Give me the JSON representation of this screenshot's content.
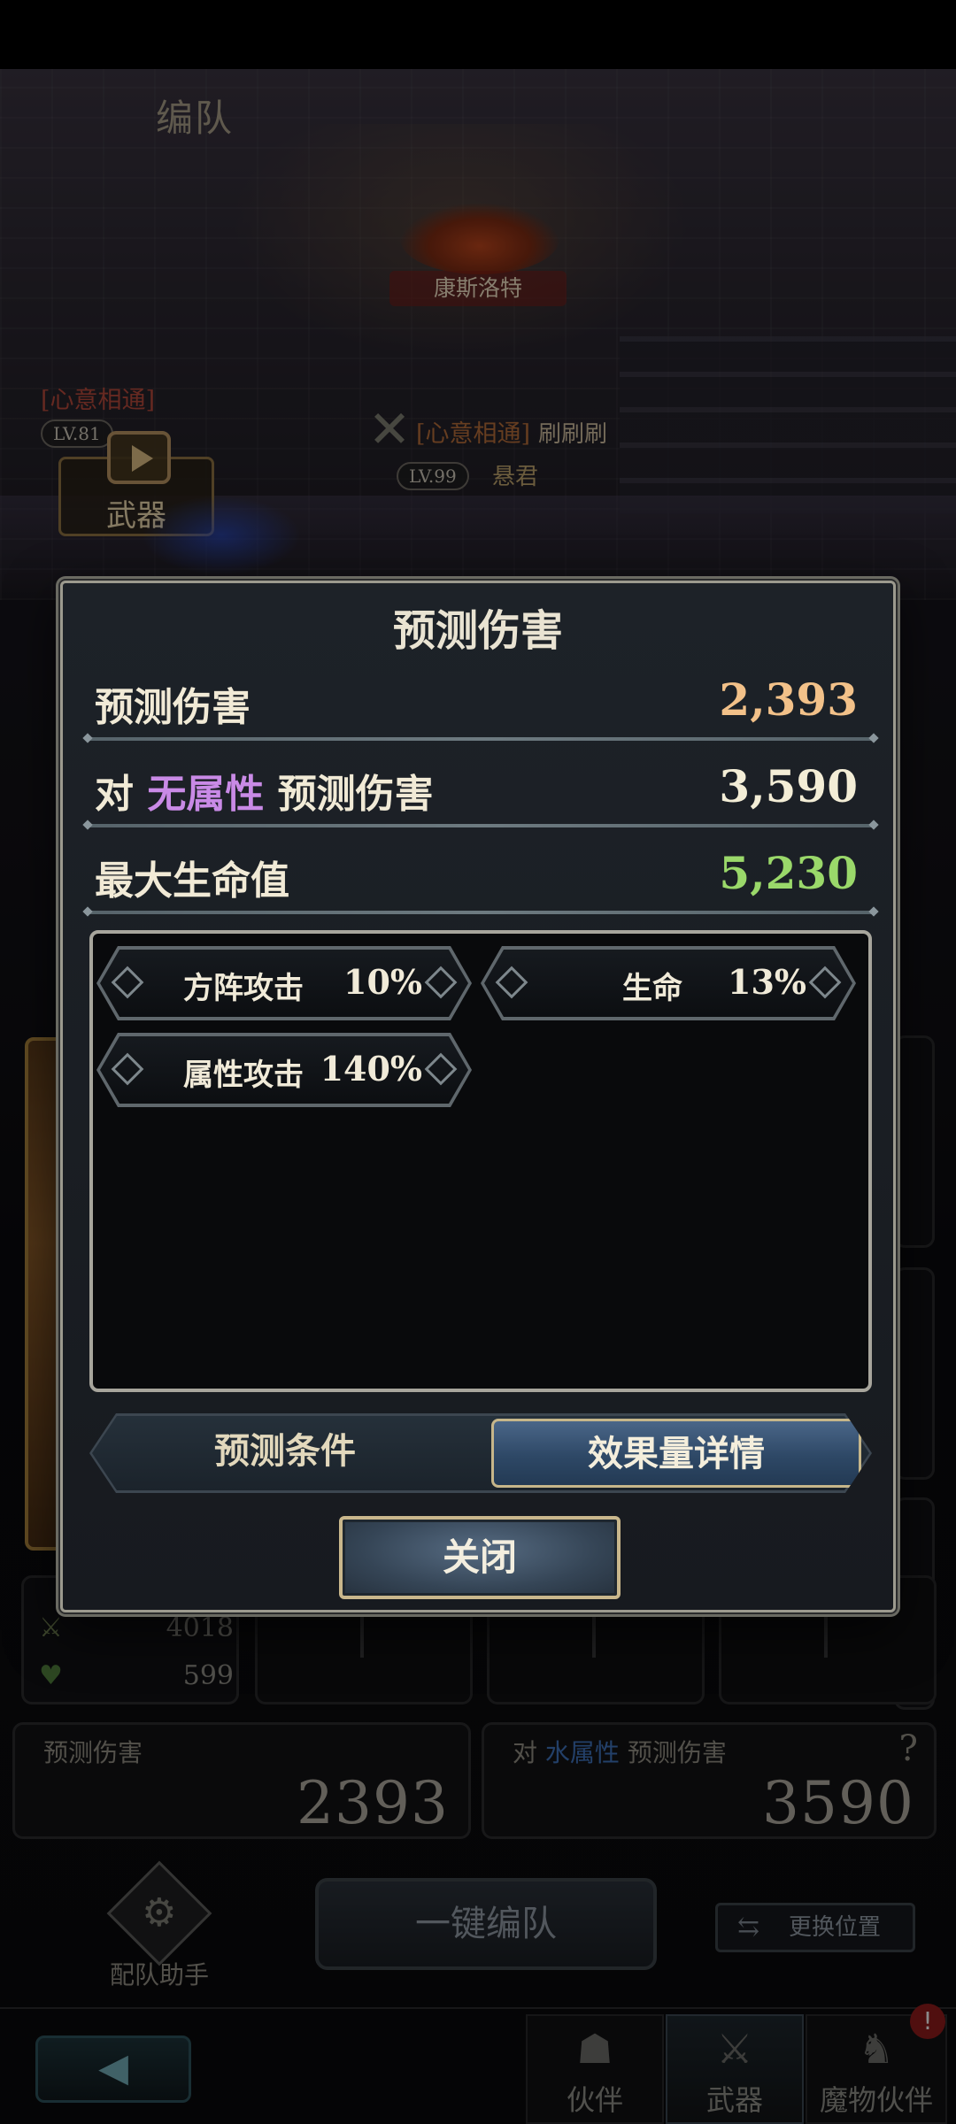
{
  "background": {
    "screen_title": "编队",
    "boss_name": "康斯洛特",
    "bond_tag_left": "[心意相通]",
    "level_left": "LV.81",
    "bond_tag_center": "[心意相通]",
    "level_center": "LV.99",
    "center_suffix": "刷刷刷",
    "center_subname": "悬君",
    "weapon_tile_label": "武器",
    "stats": {
      "attack": "4018",
      "hp": "599"
    },
    "predict_left": {
      "label": "预测伤害",
      "value": "2393"
    },
    "predict_right": {
      "prefix": "对",
      "attribute": "水属性",
      "label": "预测伤害",
      "value": "3590",
      "help": "?"
    },
    "helper_label": "配队助手",
    "one_key_button": "一键编队",
    "swap_button": "更换位置"
  },
  "bottom_nav": {
    "back_icon": "back-arrow-icon",
    "tabs": [
      {
        "label": "伙伴",
        "icon": "companion-icon"
      },
      {
        "label": "武器",
        "icon": "weapon-icon",
        "active": true
      },
      {
        "label": "魔物伙伴",
        "icon": "monster-icon"
      }
    ],
    "badge": "!"
  },
  "modal": {
    "title": "预测伤害",
    "rows": [
      {
        "label": "预测伤害",
        "value": "2,393",
        "color": "#f2c189"
      },
      {
        "label_prefix": "对",
        "label_attr": "无属性",
        "label_suffix": "预测伤害",
        "value": "3,590",
        "color": "#f3edd6"
      },
      {
        "label": "最大生命值",
        "value": "5,230",
        "color": "#9ad86a"
      }
    ],
    "effects": [
      {
        "name": "方阵攻击",
        "value": "10%"
      },
      {
        "name": "生命",
        "value": "13%"
      },
      {
        "name": "属性攻击",
        "value": "140%"
      }
    ],
    "tabs": {
      "left": "预测条件",
      "right": "效果量详情",
      "active": "right"
    },
    "close_button": "关闭"
  },
  "colors": {
    "damage": "#f2c189",
    "attribute_highlight": "#c98ae6",
    "hp": "#9ad86a",
    "water_attribute": "#3d6fb6"
  }
}
